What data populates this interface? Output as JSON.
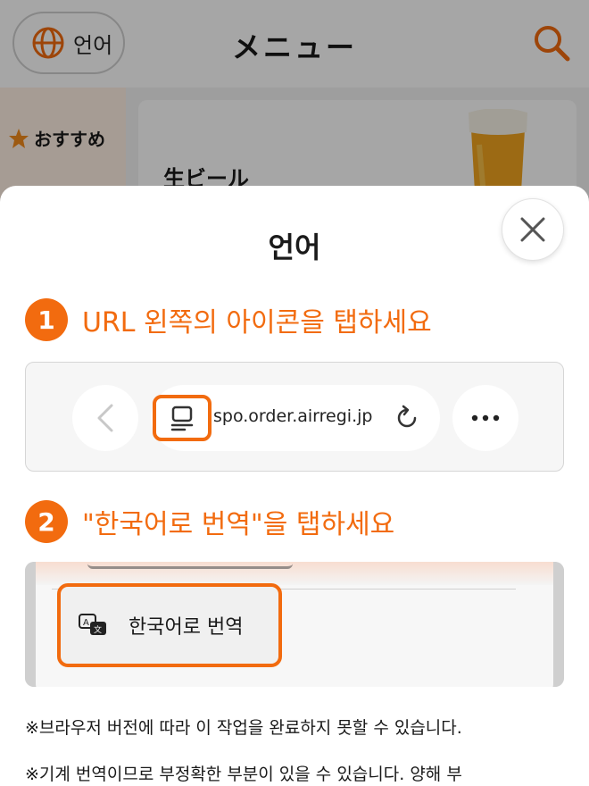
{
  "header": {
    "language_button_label": "언어",
    "title": "メニュー",
    "globe_icon": "globe-icon",
    "search_icon": "search-icon"
  },
  "sidebar": {
    "items": [
      {
        "label": "おすすめ",
        "icon": "star-icon"
      }
    ]
  },
  "menu_items": [
    {
      "name": "生ビール",
      "image": "beer-glass"
    }
  ],
  "sheet": {
    "title": "언어",
    "close_icon": "close-icon",
    "steps": [
      {
        "number": "1",
        "text": "URL 왼쪽의 아이콘을 탭하세요"
      },
      {
        "number": "2",
        "text": "\"한국어로 번역\"을 탭하세요"
      }
    ],
    "browser_illustration": {
      "url": "spo.order.airregi.jp",
      "icons": [
        "back-icon",
        "reader-icon",
        "reload-icon",
        "more-icon"
      ]
    },
    "menu_illustration": {
      "translate_label": "한국어로 번역",
      "icon": "translate-icon"
    },
    "notes": [
      "※브라우저 버전에 따라 이 작업을 완료하지 못할 수 있습니다.",
      "※기계 번역이므로 부정확한 부분이 있을 수 있습니다. 양해 부"
    ]
  },
  "colors": {
    "accent": "#f26b0f",
    "sidebar_bg": "#fff0e4"
  }
}
